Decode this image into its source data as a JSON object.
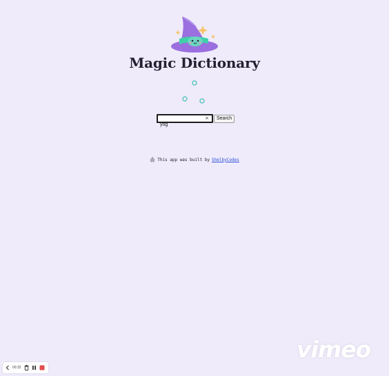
{
  "app": {
    "title": "Magic Dictionary"
  },
  "search": {
    "value": "yog",
    "clear_label": "×",
    "button_label": "Search"
  },
  "credit": {
    "prefix": "This app was built by",
    "author": "ShelbyCodes"
  },
  "recorder": {
    "time": "00:32"
  },
  "watermark": {
    "text": "vimeo"
  },
  "icons": {
    "hat": "wizard-hat-icon",
    "loader": "loading-dots-icon",
    "robot": "robot-icon",
    "back": "chevron-left-icon",
    "delete": "trash-icon",
    "pause": "pause-icon",
    "stop": "stop-icon"
  },
  "colors": {
    "background": "#efebfb",
    "hat_purple": "#9b6fdf",
    "hat_teal": "#3fd0a8",
    "sparkle": "#f7c46c",
    "loader": "#5dc6c0",
    "link": "#2a4fd6",
    "stop": "#e24c4c"
  }
}
